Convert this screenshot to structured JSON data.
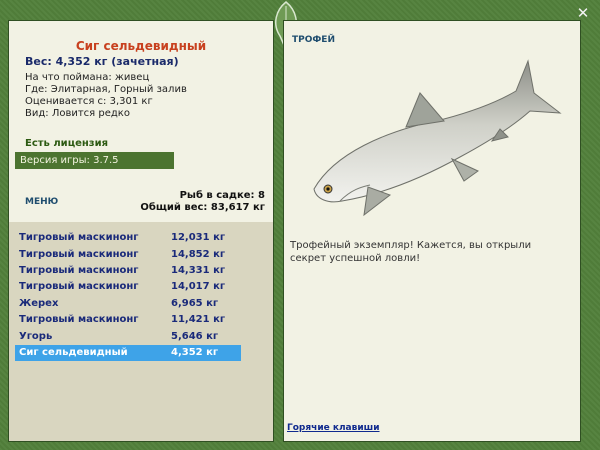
{
  "fish": {
    "title": "Сиг сельдевидный",
    "weight_line": "Вес: 4,352 кг (зачетная)",
    "bait": "На что поймана: живец",
    "location": "Где: Элитарная, Горный залив",
    "value": "Оценивается с: 3,301 кг",
    "kind": "Вид: Ловится редко"
  },
  "license": "Есть лицензия",
  "version": "Версия игры: 3.7.5",
  "menu_label": "Меню",
  "stats": {
    "count": "Рыб в садке: 8",
    "total": "Общий вес: 83,617 кг"
  },
  "catch_list": [
    {
      "name": "Тигровый маскинонг",
      "weight": "12,031 кг",
      "selected": false
    },
    {
      "name": "Тигровый маскинонг",
      "weight": "14,852 кг",
      "selected": false
    },
    {
      "name": "Тигровый маскинонг",
      "weight": "14,331 кг",
      "selected": false
    },
    {
      "name": "Тигровый маскинонг",
      "weight": "14,017 кг",
      "selected": false
    },
    {
      "name": "Жерех",
      "weight": "6,965 кг",
      "selected": false
    },
    {
      "name": "Тигровый маскинонг",
      "weight": "11,421 кг",
      "selected": false
    },
    {
      "name": "Угорь",
      "weight": "5,646 кг",
      "selected": false
    },
    {
      "name": "Сиг сельдевидный",
      "weight": "4,352 кг",
      "selected": true
    }
  ],
  "trophy": {
    "label": "Трофей",
    "description": "Трофейный экземпляр! Кажется, вы открыли секрет успешной ловли!"
  },
  "hotkeys_label": "Горячие клавиши",
  "close_icon": "close-icon",
  "colors": {
    "frame": "#52803b",
    "panel": "#f2f2e4",
    "selection": "#3ea3e8",
    "title": "#c8411f"
  }
}
